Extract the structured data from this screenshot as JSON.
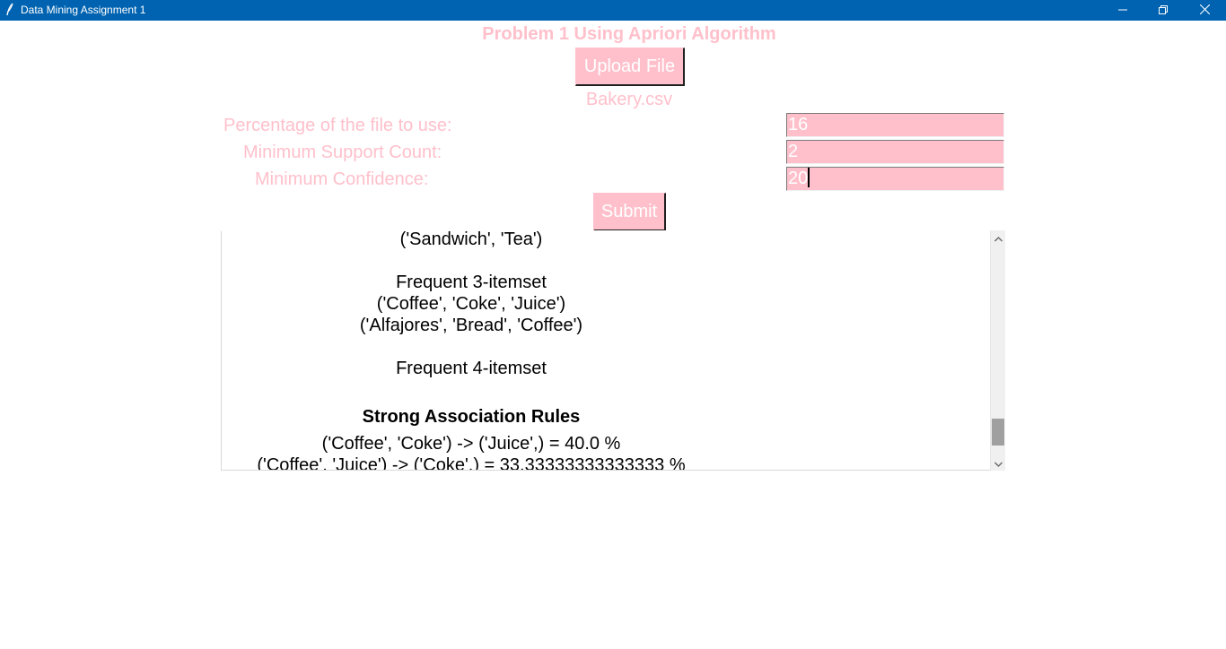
{
  "window": {
    "title": "Data Mining Assignment 1",
    "icons": [
      "feather-icon",
      "minimize-icon",
      "restore-icon",
      "close-icon"
    ]
  },
  "form": {
    "heading": "Problem 1 Using Apriori Algorithm",
    "upload_label": "Upload File",
    "filename": "Bakery.csv",
    "percentage_label": "Percentage of the file to use:",
    "percentage_value": "16",
    "support_label": "Minimum Support Count:",
    "support_value": "2",
    "confidence_label": "Minimum Confidence:",
    "confidence_value": "20",
    "submit_label": "Submit"
  },
  "output": {
    "lines": [
      "('Sandwich', 'Tea')",
      "Frequent 3-itemset",
      "('Coffee', 'Coke', 'Juice')",
      "('Alfajores', 'Bread', 'Coffee')",
      "Frequent 4-itemset",
      "Strong Association Rules",
      "('Coffee', 'Coke') -> ('Juice',) = 40.0 %",
      "('Coffee', 'Juice') -> ('Coke',) = 33.33333333333333 %"
    ],
    "scroll_position": 0.88
  },
  "colors": {
    "accent": "#ffc0cb",
    "titlebar": "#0063b1",
    "text": "#000000"
  }
}
